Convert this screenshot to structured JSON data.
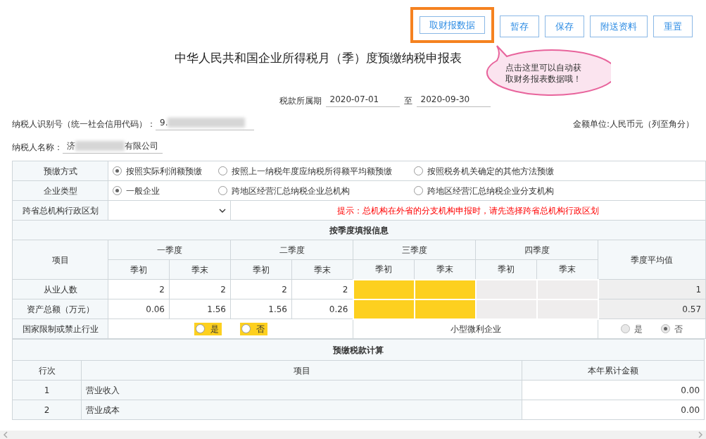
{
  "toolbar": {
    "buttons": [
      {
        "label": "取财报数据",
        "highlighted": true
      },
      {
        "label": "暂存",
        "highlighted": false
      },
      {
        "label": "保存",
        "highlighted": false
      },
      {
        "label": "附送资料",
        "highlighted": false
      },
      {
        "label": "重置",
        "highlighted": false
      }
    ]
  },
  "tooltip": {
    "lines": [
      "点击这里可以自动获",
      "取财务报表数据哦！"
    ]
  },
  "title": "中华人民共和国企业所得税月（季）度预缴纳税申报表",
  "period": {
    "label": "税款所属期",
    "start": "2020-07-01",
    "separator": "至",
    "end": "2020-09-30"
  },
  "taxpayer_id": {
    "label": "纳税人识别号（统一社会信用代码）：",
    "value": "9."
  },
  "amount_unit": "金额单位:人民币元（列至角分）",
  "taxpayer_name": {
    "label": "纳税人名称：",
    "value_start": "济",
    "value_end": "有限公司"
  },
  "prepay_method": {
    "label": "预缴方式",
    "options": [
      {
        "label": "按照实际利润额预缴",
        "selected": true
      },
      {
        "label": "按照上一纳税年度应纳税所得额平均额预缴",
        "selected": false
      },
      {
        "label": "按照税务机关确定的其他方法预缴",
        "selected": false
      }
    ]
  },
  "enterprise_type": {
    "label": "企业类型",
    "options": [
      {
        "label": "一般企业",
        "selected": true
      },
      {
        "label": "跨地区经营汇总纳税企业总机构",
        "selected": false
      },
      {
        "label": "跨地区经营汇总纳税企业分支机构",
        "selected": false
      }
    ]
  },
  "region": {
    "label": "跨省总机构行政区划",
    "hint": "提示：总机构在外省的分支机构申报时，请先选择跨省总机构行政区划"
  },
  "quarterly": {
    "title": "按季度填报信息",
    "item_header": "项目",
    "quarters": [
      {
        "name": "一季度",
        "subs": [
          "季初",
          "季末"
        ]
      },
      {
        "name": "二季度",
        "subs": [
          "季初",
          "季末"
        ]
      },
      {
        "name": "三季度",
        "subs": [
          "季初",
          "季末"
        ]
      },
      {
        "name": "四季度",
        "subs": [
          "季初",
          "季末"
        ]
      }
    ],
    "average_header": "季度平均值",
    "rows": [
      {
        "label": "从业人数",
        "cells": [
          {
            "kind": "value",
            "value": "2"
          },
          {
            "kind": "value",
            "value": "2"
          },
          {
            "kind": "value",
            "value": "2"
          },
          {
            "kind": "value",
            "value": "2"
          },
          {
            "kind": "highlight"
          },
          {
            "kind": "highlight"
          },
          {
            "kind": "locked"
          },
          {
            "kind": "locked"
          }
        ],
        "average": "1"
      },
      {
        "label": "资产总额（万元）",
        "cells": [
          {
            "kind": "value",
            "value": "0.06"
          },
          {
            "kind": "value",
            "value": "1.56"
          },
          {
            "kind": "value",
            "value": "1.56"
          },
          {
            "kind": "value",
            "value": "0.26"
          },
          {
            "kind": "highlight"
          },
          {
            "kind": "highlight"
          },
          {
            "kind": "locked"
          },
          {
            "kind": "locked"
          }
        ],
        "average": "0.57"
      }
    ]
  },
  "restricted": {
    "label": "国家限制或禁止行业",
    "highlighted": true,
    "options": [
      {
        "label": "是",
        "selected": false
      },
      {
        "label": "否",
        "selected": false
      }
    ]
  },
  "small_micro": {
    "label": "小型微利企业",
    "disabled": true,
    "options": [
      {
        "label": "是",
        "selected": false
      },
      {
        "label": "否",
        "selected": true
      }
    ]
  },
  "calculation": {
    "title": "预缴税款计算",
    "columns": [
      "行次",
      "项目",
      "本年累计金额"
    ],
    "rows": [
      {
        "line": "1",
        "item": "营业收入",
        "amount": "0.00"
      },
      {
        "line": "2",
        "item": "营业成本",
        "amount": "0.00"
      }
    ]
  }
}
